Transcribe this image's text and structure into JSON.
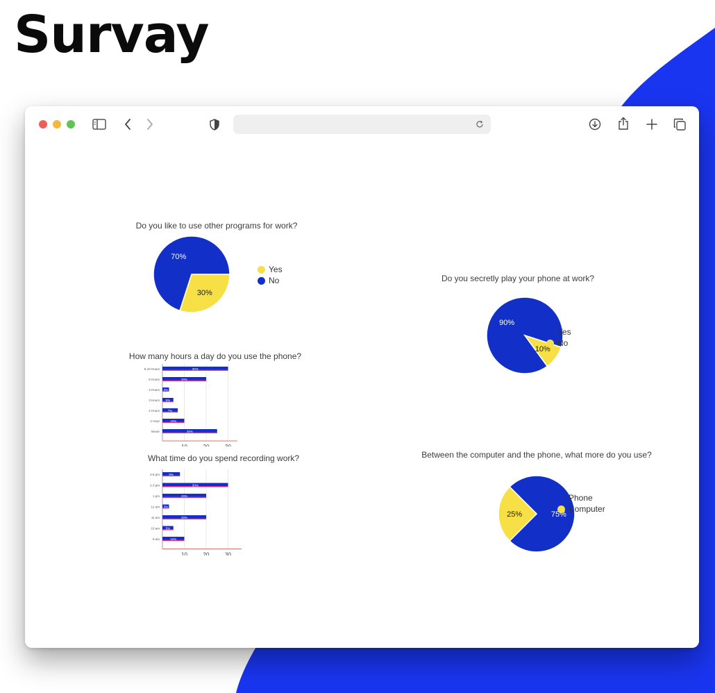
{
  "page": {
    "title": "Survay"
  },
  "colors": {
    "blue": "#1230c8",
    "yellow": "#f7e046",
    "accent_bg": "#1a35f0",
    "bar_line": "#e0347a"
  },
  "browser": {
    "address_text": "",
    "icons": [
      "sidebar-icon",
      "back-icon",
      "forward-icon",
      "shield-icon",
      "reload-icon",
      "download-icon",
      "share-icon",
      "new-tab-icon",
      "tabs-icon"
    ]
  },
  "chart_data": [
    {
      "type": "pie",
      "title": "Do you like to use other programs for work?",
      "labels": [
        "Yes",
        "No"
      ],
      "values": [
        30,
        70
      ],
      "value_labels": [
        "30%",
        "70%"
      ],
      "colors": [
        "#f7e046",
        "#1230c8"
      ],
      "legend_position": "right"
    },
    {
      "type": "bar",
      "orientation": "horizontal",
      "title": "How many hours a day do you use the phone?",
      "categories": [
        "6-10 Hours",
        "5 Hours",
        "4 Hours",
        "3 Hours",
        "2 Hours",
        "1 Hour",
        "Never"
      ],
      "values": [
        30,
        20,
        3,
        5,
        7,
        10,
        25
      ],
      "value_labels": [
        "30%",
        "20%",
        "3%",
        "5%",
        "7%",
        "10%",
        "25%"
      ],
      "x_ticks": [
        10,
        20,
        30
      ],
      "xlim": [
        0,
        34
      ]
    },
    {
      "type": "bar",
      "orientation": "horizontal",
      "title": "What time do you spend recording work?",
      "categories": [
        "4-6 pm",
        "2-3 pm",
        "1 pm",
        "12 am",
        "11 am",
        "10 am",
        "9 am"
      ],
      "values": [
        8,
        30,
        20,
        3,
        20,
        5,
        10
      ],
      "value_labels": [
        "8%",
        "30%",
        "20%",
        "3%",
        "20%",
        "5%",
        "10%"
      ],
      "x_ticks": [
        10,
        20,
        30
      ],
      "xlim": [
        0,
        36
      ]
    },
    {
      "type": "pie",
      "title": "Do you secretly play your phone at work?",
      "labels": [
        "Yes",
        "No"
      ],
      "values": [
        90,
        10
      ],
      "value_labels": [
        "90%",
        "10%"
      ],
      "colors": [
        "#1230c8",
        "#f7e046"
      ],
      "legend_position": "right"
    },
    {
      "type": "pie",
      "title": "Between the computer and the phone, what more do you use?",
      "labels": [
        "Phone",
        "Computer"
      ],
      "values": [
        75,
        25
      ],
      "value_labels": [
        "75%",
        "25%"
      ],
      "colors": [
        "#1230c8",
        "#f7e046"
      ],
      "legend_position": "right"
    }
  ]
}
